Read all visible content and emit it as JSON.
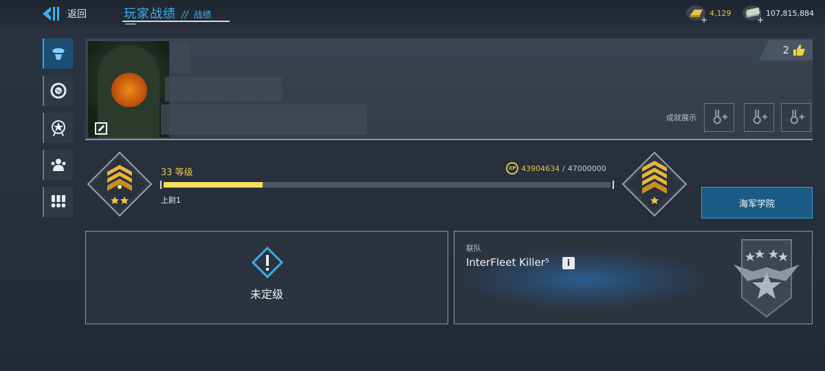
{
  "topbar": {
    "back_label": "返回",
    "title": "玩家战绩",
    "title_sep": "//",
    "title_sub": "战绩"
  },
  "currency": {
    "gold": "4,129",
    "cash": "107,815,884",
    "gold_color": "#e7c34a"
  },
  "sidebar": {
    "items": [
      {
        "icon": "captain-icon",
        "active": true
      },
      {
        "icon": "percentage-icon",
        "active": false
      },
      {
        "icon": "star-emblem-icon",
        "active": false
      },
      {
        "icon": "crew-icon",
        "active": false
      },
      {
        "icon": "medals-icon",
        "active": false
      }
    ]
  },
  "profile": {
    "likes": "2",
    "achievements_label": "成就展示",
    "achievement_slots": 3
  },
  "rank": {
    "level": "33 等级",
    "xp_current": "43904634",
    "xp_sep": "/",
    "xp_max": "47000000",
    "xp_icon_text": "XP",
    "progress": 0.222,
    "rank_name": "上尉1",
    "academy_button": "海军学院"
  },
  "rated": {
    "label": "未定级"
  },
  "fleet": {
    "heading": "联队",
    "name": "InterFleet Killer⁵",
    "info": "i"
  },
  "colors": {
    "accent": "#32a8ec",
    "progress_fill": "#f3e15a"
  }
}
